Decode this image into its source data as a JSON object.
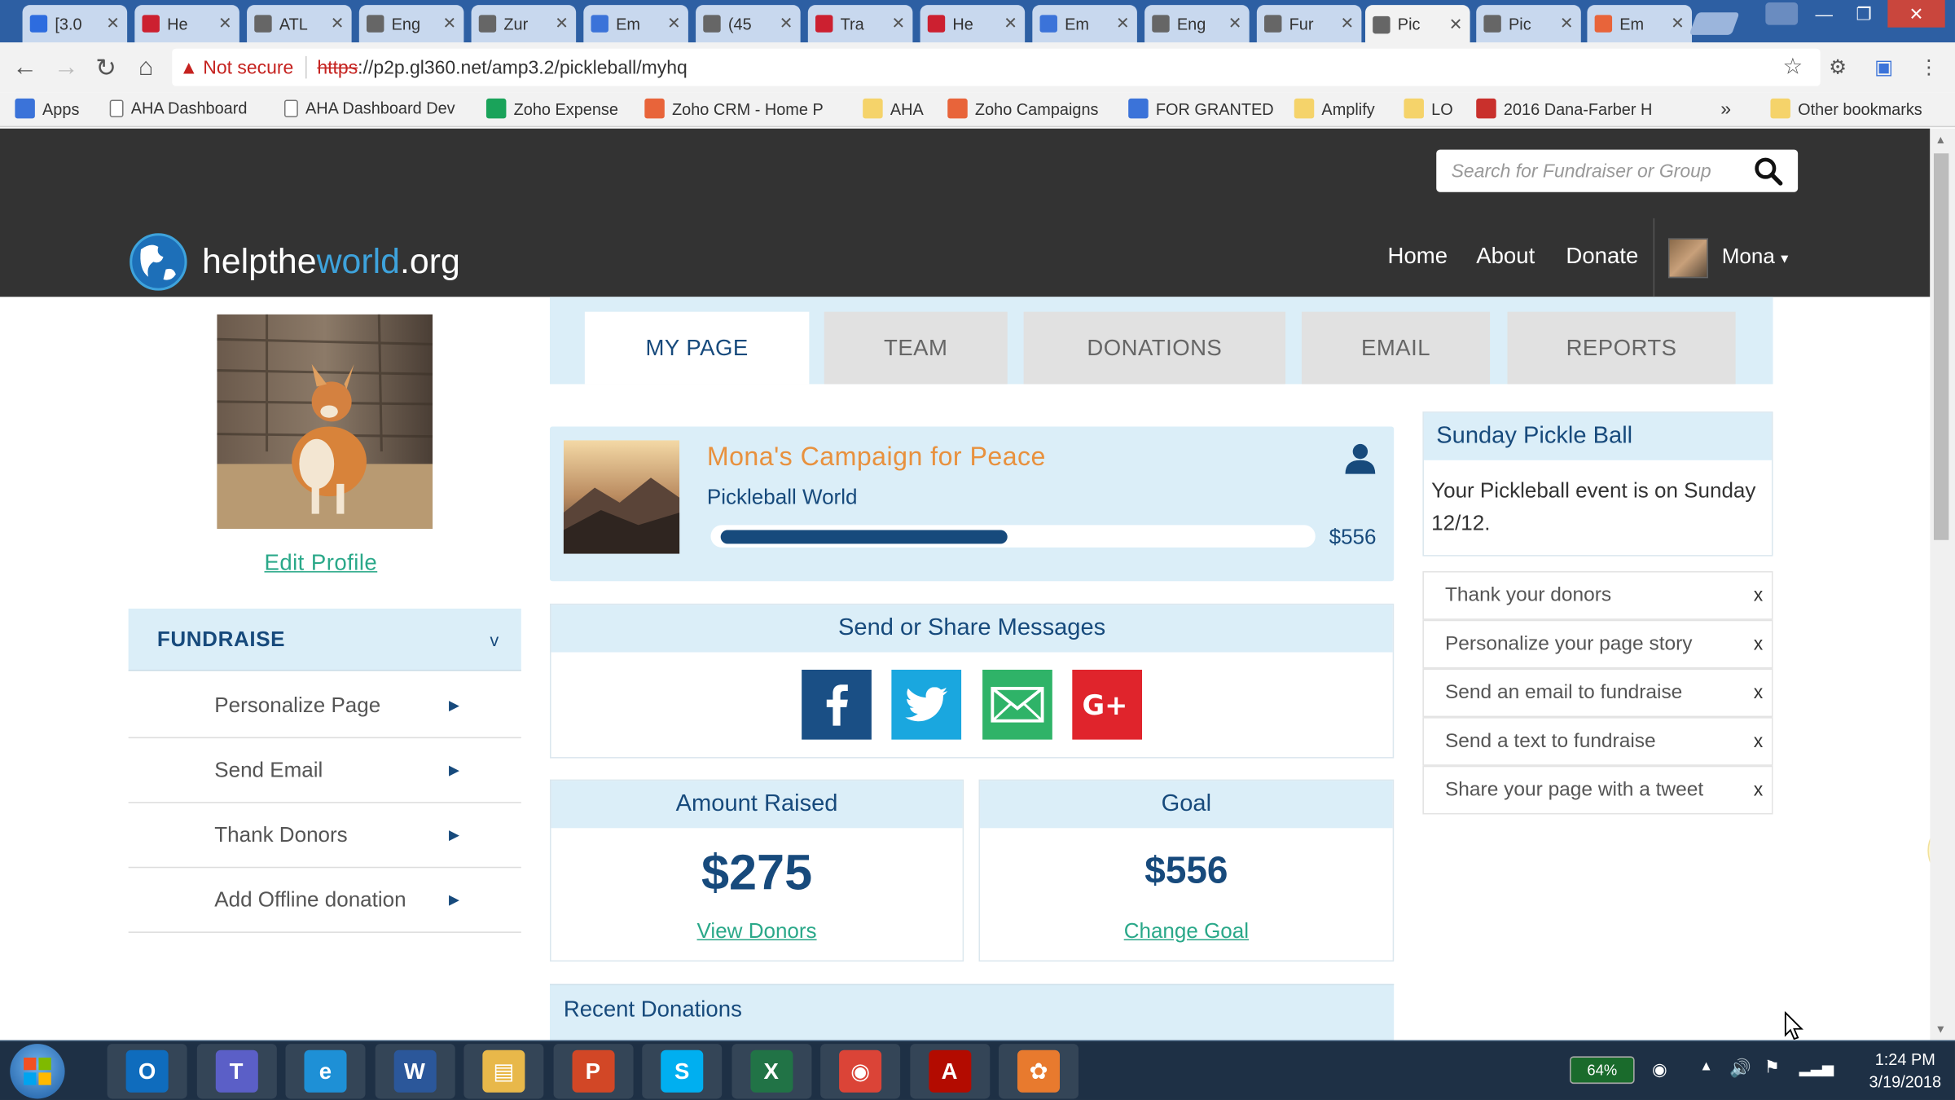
{
  "browser": {
    "tabs": [
      {
        "label": "[3.0",
        "icon": "jira-icon",
        "color": "#2d6cdf"
      },
      {
        "label": "He",
        "icon": "aha-heart-icon",
        "color": "#cc2030"
      },
      {
        "label": "ATL",
        "icon": "page-icon",
        "color": "#666"
      },
      {
        "label": "Eng",
        "icon": "page-icon",
        "color": "#666"
      },
      {
        "label": "Zur",
        "icon": "page-icon",
        "color": "#666"
      },
      {
        "label": "Em",
        "icon": "docs-icon",
        "color": "#3b73d9"
      },
      {
        "label": "(45",
        "icon": "check-icon",
        "color": "#666"
      },
      {
        "label": "Tra",
        "icon": "heart-icon",
        "color": "#cc2030"
      },
      {
        "label": "He",
        "icon": "aha-heart-icon",
        "color": "#cc2030"
      },
      {
        "label": "Em",
        "icon": "docs-icon",
        "color": "#3b73d9"
      },
      {
        "label": "Eng",
        "icon": "page-icon",
        "color": "#666"
      },
      {
        "label": "Fur",
        "icon": "page-icon",
        "color": "#666"
      },
      {
        "label": "Pic",
        "icon": "page-icon",
        "color": "#666",
        "active": true
      },
      {
        "label": "Pic",
        "icon": "page-icon",
        "color": "#666"
      },
      {
        "label": "Em",
        "icon": "zoho-icon",
        "color": "#e8643a"
      }
    ],
    "security_label": "Not secure",
    "url_scheme": "https",
    "url_rest": "://p2p.gl360.net/amp3.2/pickleball/myhq",
    "bookmarks": [
      {
        "label": "Apps",
        "icon": "apps-grid-icon"
      },
      {
        "label": "AHA Dashboard",
        "icon": "page-icon"
      },
      {
        "label": "AHA Dashboard Dev",
        "icon": "page-icon"
      },
      {
        "label": "Zoho Expense",
        "icon": "zoho-expense-icon"
      },
      {
        "label": "Zoho CRM - Home P",
        "icon": "zoho-crm-icon"
      },
      {
        "label": "AHA",
        "icon": "folder-icon"
      },
      {
        "label": "Zoho Campaigns",
        "icon": "zoho-campaigns-icon"
      },
      {
        "label": "FOR GRANTED",
        "icon": "grid-icon"
      },
      {
        "label": "Amplify",
        "icon": "folder-icon"
      },
      {
        "label": "LO",
        "icon": "folder-icon"
      },
      {
        "label": "2016 Dana-Farber H",
        "icon": "pdf-icon"
      }
    ],
    "overflow_label": "»",
    "other_bookmarks": "Other bookmarks"
  },
  "site": {
    "search_placeholder": "Search for Fundraiser or Group",
    "logo_pre": "helpthe",
    "logo_hl": "world",
    "logo_post": ".org",
    "nav": {
      "home": "Home",
      "about": "About",
      "donate": "Donate"
    },
    "user_name": "Mona",
    "user_caret": "▾"
  },
  "sidebar": {
    "edit_profile": "Edit Profile",
    "section_title": "FUNDRAISE",
    "section_chevron": "v",
    "items": [
      {
        "label": "Personalize Page"
      },
      {
        "label": "Send Email"
      },
      {
        "label": "Thank Donors"
      },
      {
        "label": "Add Offline donation"
      }
    ]
  },
  "tabs": [
    {
      "label": "MY PAGE",
      "active": true
    },
    {
      "label": "TEAM"
    },
    {
      "label": "DONATIONS"
    },
    {
      "label": "EMAIL"
    },
    {
      "label": "REPORTS"
    }
  ],
  "campaign": {
    "title": "Mona's Campaign for Peace",
    "subtitle": "Pickleball World",
    "progress_fraction": 0.49,
    "goal_amount": "$556"
  },
  "share": {
    "title": "Send or Share Messages",
    "buttons": [
      "facebook-icon",
      "twitter-icon",
      "email-icon",
      "google-plus-icon"
    ]
  },
  "amount_raised": {
    "title": "Amount Raised",
    "value": "$275",
    "link": "View Donors"
  },
  "goal": {
    "title": "Goal",
    "value": "$556",
    "link": "Change Goal"
  },
  "recent_donations": {
    "title": "Recent Donations"
  },
  "event": {
    "title": "Sunday Pickle Ball",
    "body": "Your Pickleball event is on Sunday 12/12."
  },
  "todos": [
    {
      "label": "Thank your donors",
      "close": "x"
    },
    {
      "label": "Personalize your page story",
      "close": "x"
    },
    {
      "label": "Send an email to fundraise",
      "close": "x"
    },
    {
      "label": "Send a text to fundraise",
      "close": "x"
    },
    {
      "label": "Share your page with a tweet",
      "close": "x"
    }
  ],
  "taskbar": {
    "apps": [
      "outlook-icon",
      "teams-icon",
      "internet-explorer-icon",
      "word-icon",
      "file-explorer-icon",
      "powerpoint-icon",
      "skype-icon",
      "excel-icon",
      "chrome-icon",
      "acrobat-icon",
      "flower-app-icon"
    ],
    "battery": "64%",
    "time": "1:24 PM",
    "date": "3/19/2018"
  },
  "colors": {
    "brand_blue": "#174a7c",
    "accent_orange": "#e8913e",
    "link_green": "#2aa889",
    "panel_bg": "#dbeef8",
    "header_bg": "#333333"
  }
}
